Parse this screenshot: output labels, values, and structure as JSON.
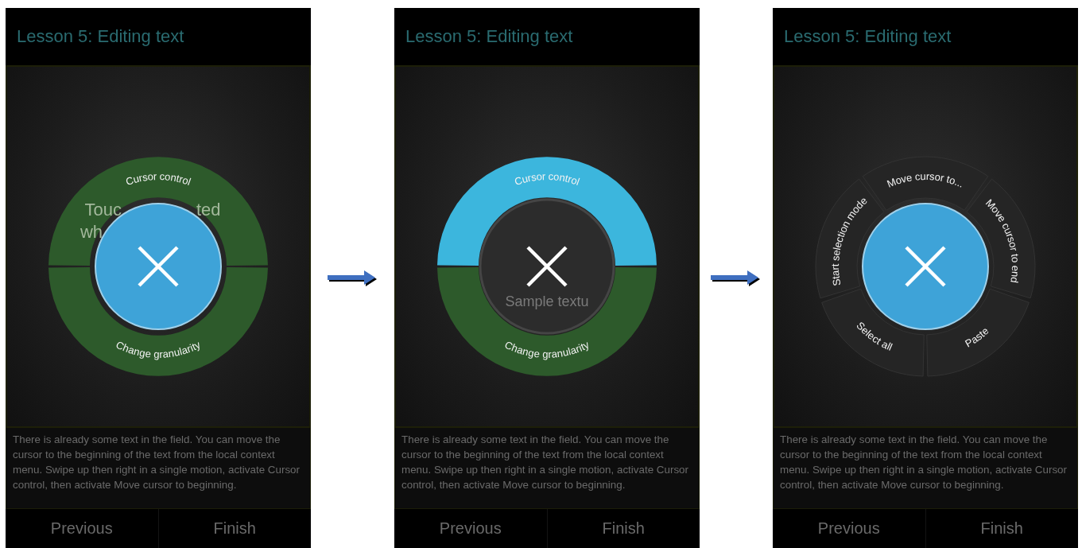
{
  "screens": [
    {
      "title": "Lesson 5: Editing text",
      "background_text": [
        "Touc",
        "ted",
        "wh"
      ],
      "menu": {
        "center_selected": true,
        "segments": [
          {
            "label": "Cursor control",
            "kind": "group",
            "selected": false
          },
          {
            "label": "Change granularity",
            "kind": "group",
            "selected": false
          }
        ]
      },
      "instructions": "There is already some text in the field. You can move the cursor to the beginning of the text from the local context menu. Swipe up then right in a single motion, activate Cursor control, then activate Move cursor to beginning.",
      "buttons": [
        "Previous",
        "Finish"
      ]
    },
    {
      "title": "Lesson 5: Editing text",
      "background_text": [
        "Sample textu"
      ],
      "menu": {
        "center_selected": false,
        "segments": [
          {
            "label": "Cursor control",
            "kind": "group",
            "selected": true
          },
          {
            "label": "Change granularity",
            "kind": "group",
            "selected": false
          }
        ]
      },
      "instructions": "There is already some text in the field. You can move the cursor to the beginning of the text from the local context menu. Swipe up then right in a single motion, activate Cursor control, then activate Move cursor to beginning.",
      "buttons": [
        "Previous",
        "Finish"
      ]
    },
    {
      "title": "Lesson 5: Editing text",
      "menu": {
        "center_selected": true,
        "segments": [
          {
            "label": "Move cursor to...",
            "kind": "action",
            "selected": false
          },
          {
            "label": "Move cursor to end",
            "kind": "action",
            "selected": false
          },
          {
            "label": "Paste",
            "kind": "action",
            "selected": false
          },
          {
            "label": "Select all",
            "kind": "action",
            "selected": false
          },
          {
            "label": "Start selection mode",
            "kind": "action",
            "selected": false
          }
        ]
      },
      "instructions": "There is already some text in the field. You can move the cursor to the beginning of the text from the local context menu. Swipe up then right in a single motion, activate Cursor control, then activate Move cursor to beginning.",
      "buttons": [
        "Previous",
        "Finish"
      ]
    }
  ]
}
